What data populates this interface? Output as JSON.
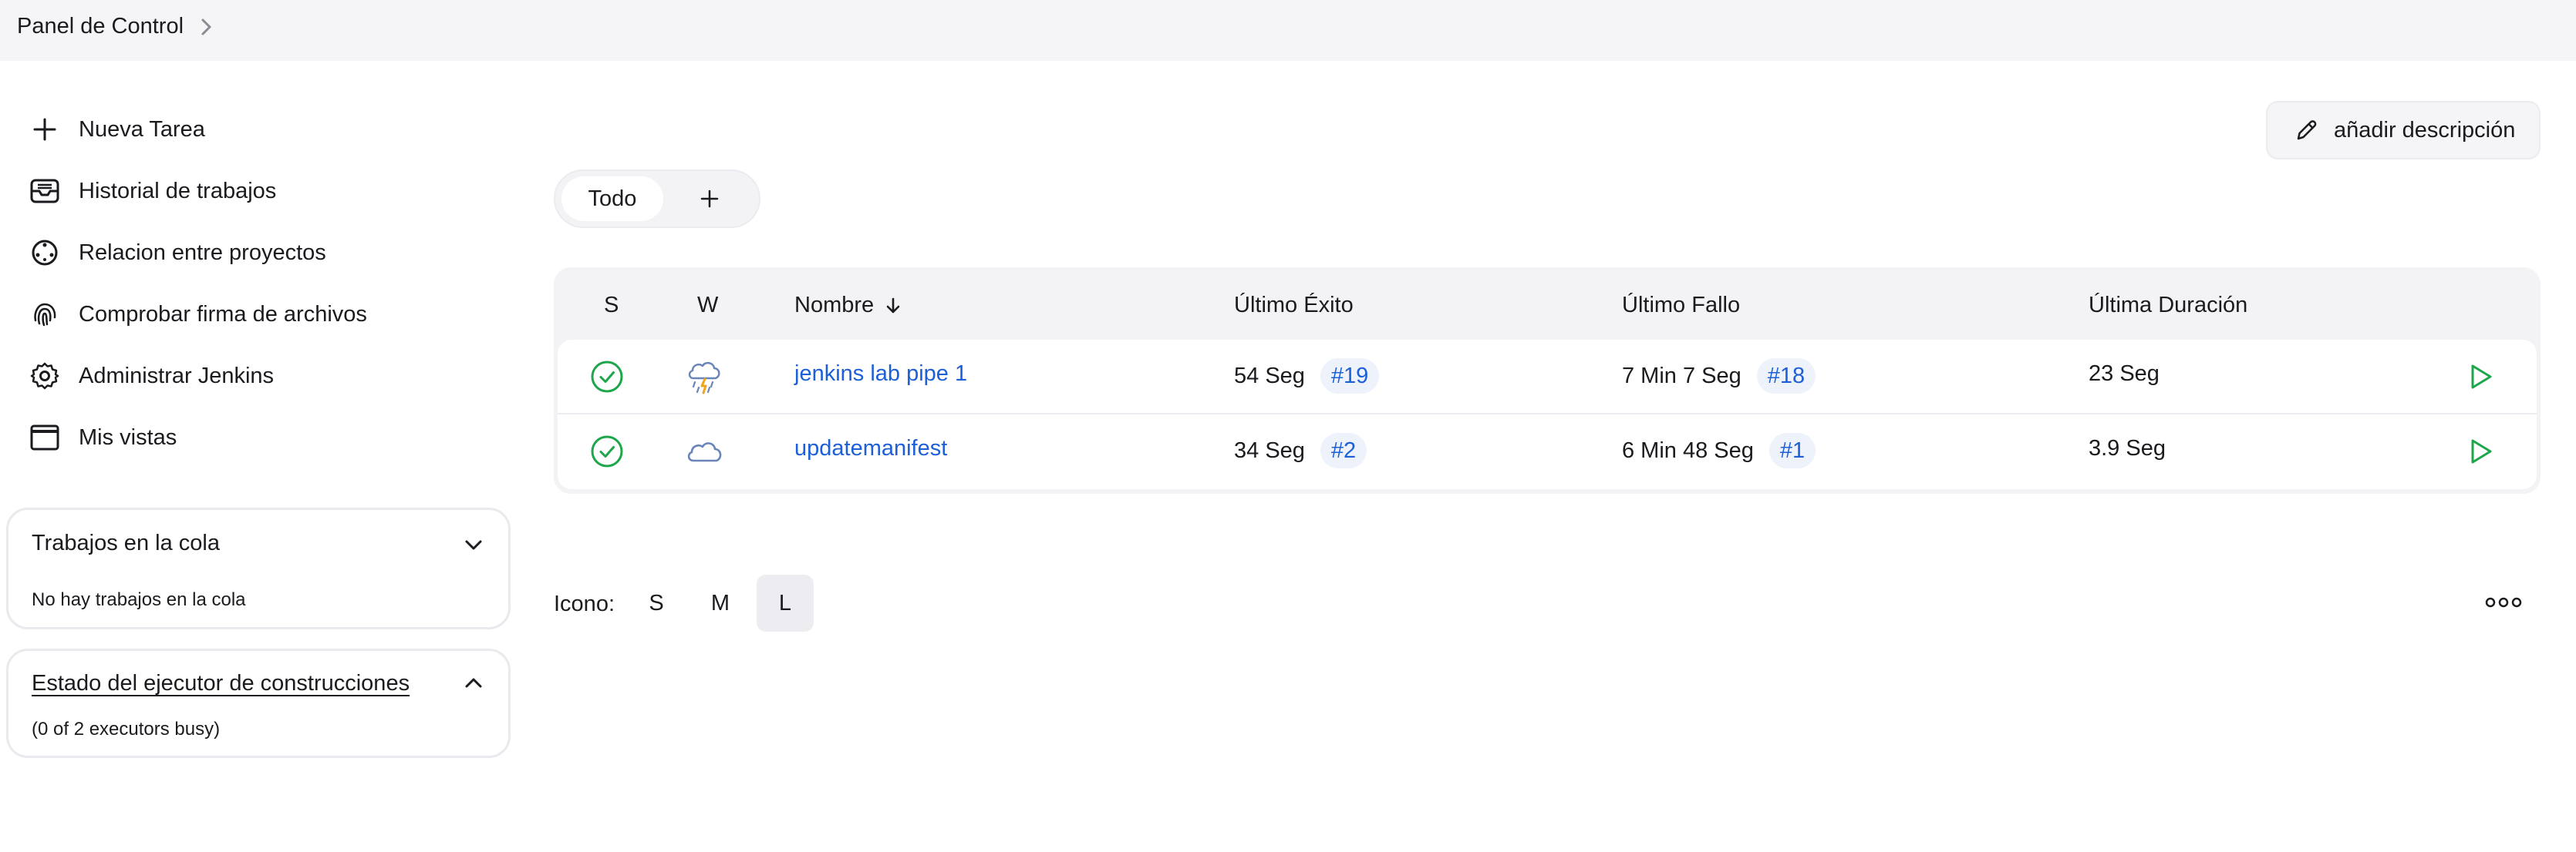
{
  "breadcrumb": {
    "root": "Panel de Control"
  },
  "sidebar": {
    "items": [
      {
        "label": "Nueva Tarea",
        "icon": "plus-icon"
      },
      {
        "label": "Historial de trabajos",
        "icon": "inbox-icon"
      },
      {
        "label": "Relacion entre proyectos",
        "icon": "relationship-icon"
      },
      {
        "label": "Comprobar firma de archivos",
        "icon": "fingerprint-icon"
      },
      {
        "label": "Administrar Jenkins",
        "icon": "gear-icon"
      },
      {
        "label": "Mis vistas",
        "icon": "window-icon"
      }
    ],
    "queue": {
      "title": "Trabajos en la cola",
      "empty": "No hay trabajos en la cola"
    },
    "executors": {
      "title": "Estado del ejecutor de construcciones",
      "status": "(0 of 2 executors busy)"
    }
  },
  "main": {
    "add_description": "añadir descripción",
    "tabs": [
      {
        "label": "Todo"
      }
    ],
    "table": {
      "headers": {
        "s": "S",
        "w": "W",
        "name": "Nombre",
        "last_success": "Último Éxito",
        "last_failure": "Último Fallo",
        "last_duration": "Última Duración"
      },
      "rows": [
        {
          "status": "success",
          "weather": "thunderstorm",
          "name": "jenkins lab pipe 1",
          "last_success": "54 Seg",
          "last_success_build": "#19",
          "last_failure": "7 Min 7 Seg",
          "last_failure_build": "#18",
          "last_duration": "23 Seg"
        },
        {
          "status": "success",
          "weather": "cloudy",
          "name": "updatemanifest",
          "last_success": "34 Seg",
          "last_success_build": "#2",
          "last_failure": "6 Min 48 Seg",
          "last_failure_build": "#1",
          "last_duration": "3.9 Seg"
        }
      ]
    },
    "icon_size": {
      "label": "Icono:",
      "options": [
        "S",
        "M",
        "L"
      ],
      "selected": "L"
    }
  },
  "colors": {
    "accent": "#1c5fd6",
    "success": "#1ea64b",
    "panel": "#f3f3f6",
    "weather_stroke": "#6a86b8",
    "lightning": "#f0a51c"
  }
}
